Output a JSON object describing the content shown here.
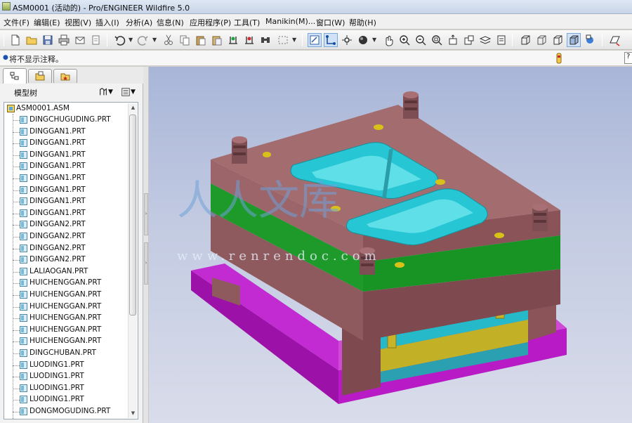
{
  "window": {
    "title": "ASM0001 (活动的) - Pro/ENGINEER Wildfire 5.0"
  },
  "menubar": {
    "items": [
      "文件(F)",
      "编辑(E)",
      "视图(V)",
      "插入(I)",
      "分析(A)",
      "信息(N)",
      "应用程序(P)",
      "工具(T)",
      "Manikin(M)...",
      "窗口(W)",
      "帮助(H)"
    ]
  },
  "toolbar": {
    "icons": [
      "new-icon",
      "open-icon",
      "save-icon",
      "print-icon",
      "send-icon",
      "copy-format-icon",
      "undo-icon",
      "redo-icon",
      "cut-icon",
      "copy-icon",
      "paste-icon",
      "paste-special-icon",
      "regenerate-icon",
      "regenerate-manager-icon",
      "select-box-icon",
      "repaint-icon",
      "spin-center-icon",
      "named-views-icon",
      "appearance-icon",
      "orient-mode-icon",
      "zoom-in-icon",
      "zoom-out-icon",
      "refit-icon",
      "reorient-icon",
      "saved-views-icon",
      "layers-icon",
      "view-manager-icon",
      "wireframe-icon",
      "hidden-line-icon",
      "no-hidden-icon",
      "shading-icon",
      "enhanced-realism-icon",
      "datum-planes-icon"
    ]
  },
  "message": {
    "text": "将不显示注释。",
    "input_value": "?"
  },
  "navigator": {
    "tabs": [
      "model-tree-tab",
      "folder-browser-tab",
      "favorites-tab"
    ],
    "tree_title": "模型树",
    "root": "ASM0001.ASM",
    "items": [
      "DINGCHUGUDING.PRT",
      "DINGGAN1.PRT",
      "DINGGAN1.PRT",
      "DINGGAN1.PRT",
      "DINGGAN1.PRT",
      "DINGGAN1.PRT",
      "DINGGAN1.PRT",
      "DINGGAN1.PRT",
      "DINGGAN1.PRT",
      "DINGGAN2.PRT",
      "DINGGAN2.PRT",
      "DINGGAN2.PRT",
      "DINGGAN2.PRT",
      "LALIAOGAN.PRT",
      "HUICHENGGAN.PRT",
      "HUICHENGGAN.PRT",
      "HUICHENGGAN.PRT",
      "HUICHENGGAN.PRT",
      "HUICHENGGAN.PRT",
      "HUICHENGGAN.PRT",
      "DINGCHUBAN.PRT",
      "LUODING1.PRT",
      "LUODING1.PRT",
      "LUODING1.PRT",
      "LUODING1.PRT",
      "DONGMOGUDING.PRT"
    ]
  },
  "watermark": {
    "url": "www.renrendoc.com"
  },
  "colors": {
    "plate_brown": "#8e5a5d",
    "plate_green": "#1d9a2a",
    "base_purple": "#b51ec2",
    "cavity_cyan": "#28c8d6",
    "ejector_cyan": "#26b9c9",
    "ejector_yellow": "#c9b62a",
    "viewport_top": "#a9b6d8"
  }
}
